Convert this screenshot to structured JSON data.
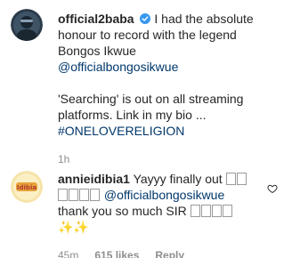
{
  "post": {
    "username": "official2baba",
    "text_line1": "I had the absolute honour to record with the legend Bongos Ikwue",
    "mention": "@officialbongosikwue",
    "text_para2": "'Searching' is out on all streaming platforms. Link in my bio ...",
    "hashtag": "#ONELOVERELIGION",
    "time": "1h"
  },
  "reply": {
    "username": "annieidibia1",
    "text_before": "Yayyy finally out",
    "emoji_count_1": 6,
    "mention": "@officialbongosikwue",
    "text_after": "thank you so much SIR",
    "emoji_count_2": 4,
    "sparkles": "✨✨",
    "time": "45m",
    "likes": "615 likes",
    "reply_label": "Reply"
  },
  "colors": {
    "text": "#262626",
    "link": "#00376b",
    "meta": "#8e8e8e",
    "verified": "#3897f0"
  }
}
